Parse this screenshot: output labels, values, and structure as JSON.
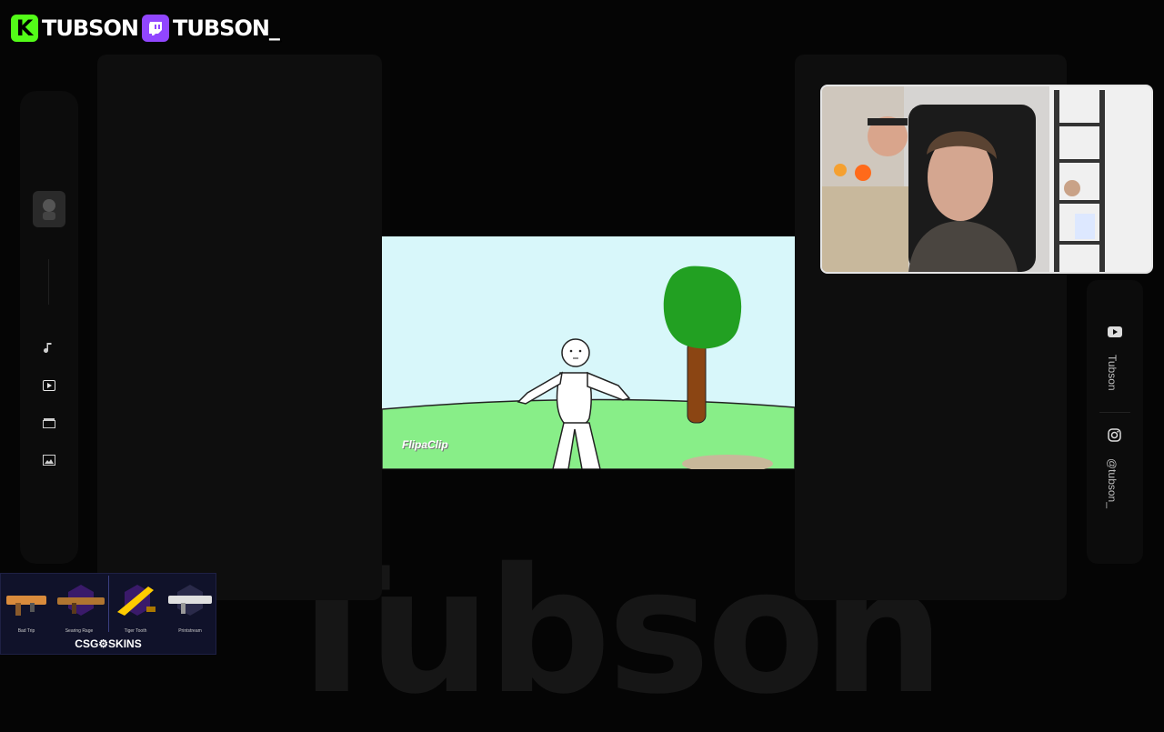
{
  "header": {
    "kick_name": "TUBSON",
    "twitch_name": "TUBSON_",
    "kick_color": "#53fc18",
    "twitch_color": "#9146ff"
  },
  "watermark": "Tubson",
  "sidebar": {
    "icons": [
      "avatar-icon",
      "music-icon",
      "play-icon",
      "clapperboard-icon",
      "image-icon"
    ]
  },
  "video": {
    "watermark_text": "FlipaClip"
  },
  "social": {
    "youtube_name": "Tubson",
    "instagram_handle": "@tubson_"
  },
  "skins_widget": {
    "brand": "CSG⚙SKINS",
    "items": [
      {
        "label": "Bad Trip",
        "color": "#d98b3c"
      },
      {
        "label": "Searing Rage",
        "color": "#9b59ff"
      },
      {
        "label": "Tiger Tooth",
        "color": "#ffcc00"
      },
      {
        "label": "Printstream",
        "color": "#e0e0e0"
      }
    ]
  }
}
